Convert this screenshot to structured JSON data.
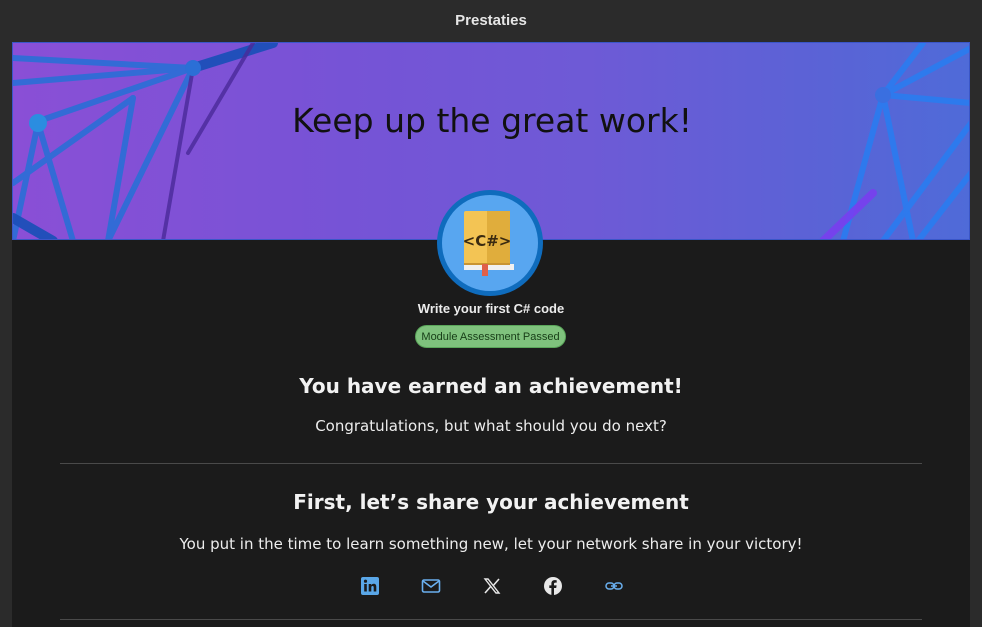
{
  "window": {
    "title": "Prestaties"
  },
  "banner": {
    "title": "Keep up the great work!"
  },
  "badge": {
    "label": "<C#>"
  },
  "module": {
    "title": "Write your first C# code",
    "status": "Module Assessment Passed"
  },
  "achievement": {
    "heading": "You have earned an achievement!",
    "subtext": "Congratulations, but what should you do next?"
  },
  "share": {
    "heading": "First, let’s share your achievement",
    "subtext": "You put in the time to learn something new, let your network share in your victory!",
    "icons": [
      "linkedin-icon",
      "mail-icon",
      "x-icon",
      "facebook-icon",
      "link-icon"
    ]
  },
  "colors": {
    "linkedin": "#5aa7e8",
    "mail": "#6ab0f0",
    "link": "#6ab0f0",
    "pill_bg": "#7fc27d",
    "badge_ring": "#0f6cbd",
    "badge_bg": "#58a6f0"
  }
}
